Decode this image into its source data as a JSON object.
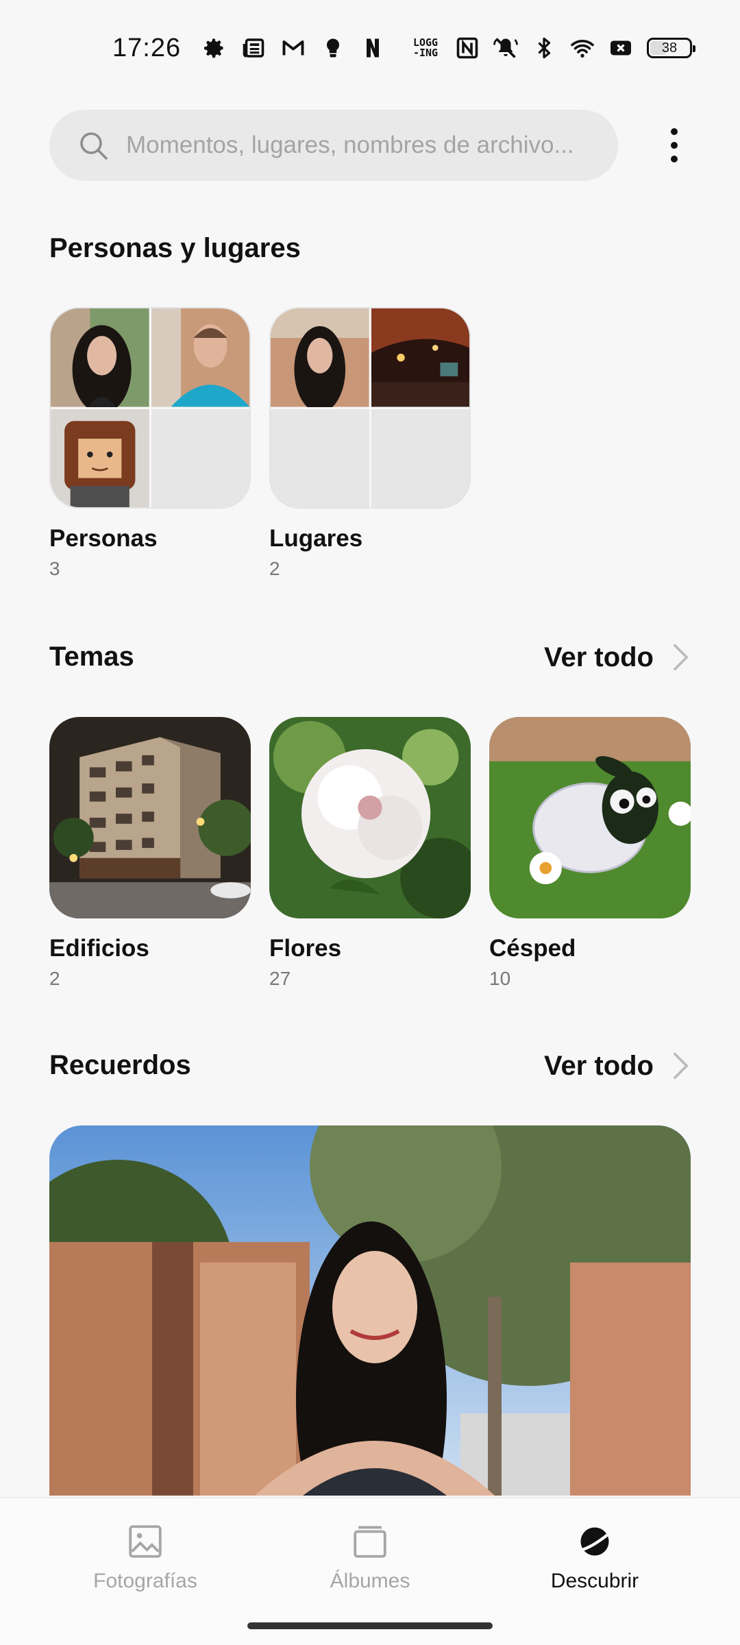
{
  "status_bar": {
    "time": "17:26",
    "left_icons": [
      "gear-icon",
      "news-icon",
      "gmail-icon",
      "bulb-icon",
      "netflix-icon"
    ],
    "logging_label": "LOGG\n-ING",
    "right_icons": [
      "nfc-icon",
      "mute-icon",
      "bluetooth-icon",
      "wifi-icon",
      "sim-x-icon"
    ],
    "battery": "38"
  },
  "search": {
    "placeholder": "Momentos, lugares, nombres de archivo..."
  },
  "sections": {
    "people_places": {
      "title": "Personas y lugares",
      "cards": [
        {
          "label": "Personas",
          "count": "3"
        },
        {
          "label": "Lugares",
          "count": "2"
        }
      ]
    },
    "themes": {
      "title": "Temas",
      "see_all": "Ver todo",
      "cards": [
        {
          "label": "Edificios",
          "count": "2"
        },
        {
          "label": "Flores",
          "count": "27"
        },
        {
          "label": "Césped",
          "count": "10"
        }
      ]
    },
    "memories": {
      "title": "Recuerdos",
      "see_all": "Ver todo"
    }
  },
  "bottom_nav": {
    "items": [
      {
        "label": "Fotografías",
        "icon": "photo-icon",
        "active": false
      },
      {
        "label": "Álbumes",
        "icon": "albums-icon",
        "active": false
      },
      {
        "label": "Descubrir",
        "icon": "planet-icon",
        "active": true
      }
    ]
  },
  "colors": {
    "background": "#f7f7f8",
    "search_bg": "#e9e9ea",
    "inactive_nav": "#a6a6a6",
    "text": "#111111"
  }
}
